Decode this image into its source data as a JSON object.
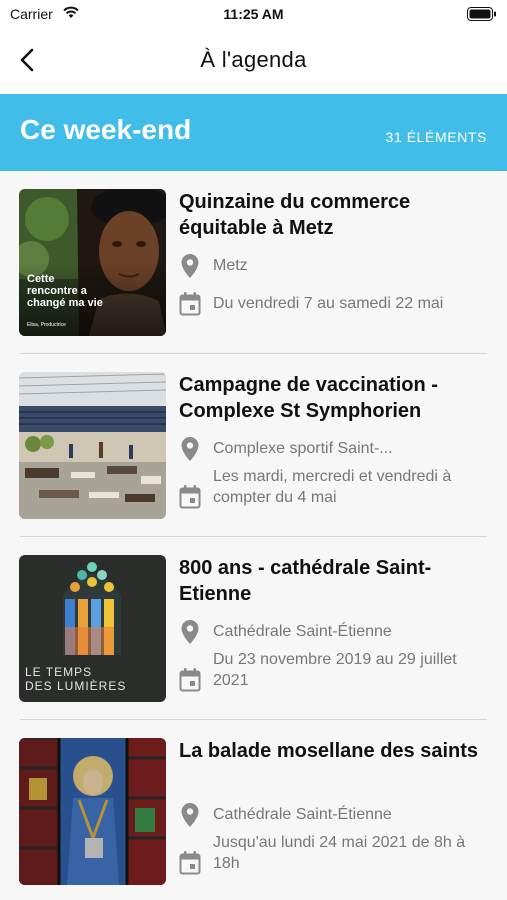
{
  "status_bar": {
    "carrier": "Carrier",
    "time": "11:25 AM"
  },
  "nav": {
    "title": "À l'agenda"
  },
  "section": {
    "title": "Ce week-end",
    "count": "31 ÉLÉMENTS"
  },
  "events": [
    {
      "title": "Quinzaine du commerce équitable à Metz",
      "location": "Metz",
      "date": "Du vendredi 7 au samedi 22 mai",
      "image_caption": "Cette rencontre a changé ma vie",
      "image_credit": "Elisa, Productrice"
    },
    {
      "title": "Campagne de vaccination - Complexe St Symphorien",
      "location": "Complexe sportif Saint-...",
      "date": "Les mardi, mercredi et vendredi à compter du 4 mai"
    },
    {
      "title": "800 ans - cathédrale Saint-Etienne",
      "location": "Cathédrale Saint-Étienne",
      "date": "Du 23 novembre 2019 au 29 juillet 2021",
      "image_caption_line1": "LE TEMPS",
      "image_caption_line2": "DES LUMIÈRES"
    },
    {
      "title": "La balade mosellane des saints",
      "location": "Cathédrale Saint-Étienne",
      "date": "Jusqu'au lundi 24 mai 2021 de 8h à 18h"
    }
  ],
  "colors": {
    "accent": "#41bde9",
    "meta_text": "#777777",
    "icon": "#8a8a8a"
  },
  "icons": {
    "back": "chevron-left",
    "location": "map-pin",
    "date": "calendar"
  }
}
